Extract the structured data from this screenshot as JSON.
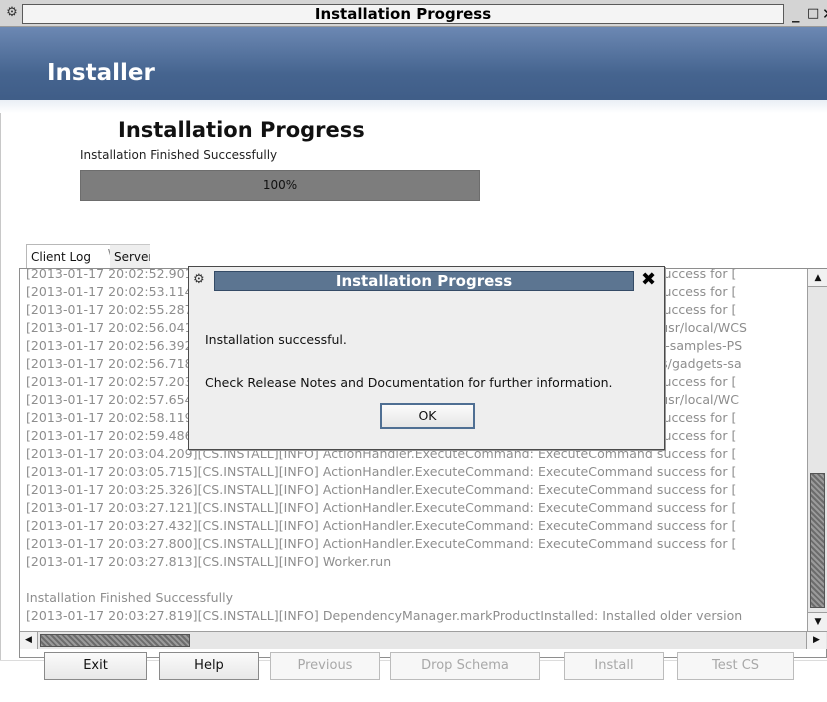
{
  "window": {
    "title": "Installation Progress",
    "menu_glyph": "⚙",
    "minimize_glyph": "_",
    "maximize_glyph": "□",
    "close_glyph": "✕"
  },
  "banner": {
    "title": "Installer"
  },
  "progress": {
    "heading": "Installation Progress",
    "status": "Installation Finished Successfully",
    "percent": 100,
    "label": "100%"
  },
  "tabs": [
    {
      "label": "Client Log",
      "active": true
    },
    {
      "label": "Server Log",
      "active": false
    }
  ],
  "log": {
    "lines": [
      "[2013-01-17 20:02:52.901][CS.INSTALL][INFO] ActionHandler.ExecuteCommand:  ExecuteCommand success for [",
      "[2013-01-17 20:02:53.114][CS.INSTALL][INFO] ActionHandler.ExecuteCommand:  ExecuteCommand success for [",
      "[2013-01-17 20:02:55.287][CS.INSTALL][INFO] ActionHandler.ExecuteCommand:  ExecuteCommand success for [",
      "[2013-01-17 20:02:56.041][CS.INSTALL][INFO] ActionHandler.ExecuteCommand:  Creating directory /usr/local/WCS",
      "[2013-01-17 20:02:56.392][CS.INSTALL][INFO] ActionHandler.ExecuteCommand:  Copying to /gadgets-samples-PS",
      "[2013-01-17 20:02:56.718][CS.INSTALL][INFO] ActionHandler.ExecuteCommand:  Copying to /home/cs/gadgets-sa",
      "[2013-01-17 20:02:57.203][CS.INSTALL][INFO] ActionHandler.ExecuteCommand:  ExecuteCommand success for [",
      "[2013-01-17 20:02:57.654][CS.INSTALL][INFO] ActionHandler.ExecuteCommand:  Creating directory /usr/local/WC",
      "[2013-01-17 20:02:58.119][CS.INSTALL][INFO] ActionHandler.ExecuteCommand:  ExecuteCommand success for [",
      "[2013-01-17 20:02:59.486][CS.INSTALL][INFO] ActionHandler.ExecuteCommand:  ExecuteCommand success for [",
      "[2013-01-17 20:03:04.209][CS.INSTALL][INFO] ActionHandler.ExecuteCommand:  ExecuteCommand success for [",
      "[2013-01-17 20:03:05.715][CS.INSTALL][INFO] ActionHandler.ExecuteCommand:  ExecuteCommand success for [",
      "[2013-01-17 20:03:25.326][CS.INSTALL][INFO] ActionHandler.ExecuteCommand:  ExecuteCommand success for [",
      "[2013-01-17 20:03:27.121][CS.INSTALL][INFO] ActionHandler.ExecuteCommand:  ExecuteCommand success for [",
      "[2013-01-17 20:03:27.432][CS.INSTALL][INFO] ActionHandler.ExecuteCommand:  ExecuteCommand success for [",
      "[2013-01-17 20:03:27.800][CS.INSTALL][INFO] ActionHandler.ExecuteCommand:  ExecuteCommand success for [",
      "[2013-01-17 20:03:27.813][CS.INSTALL][INFO] Worker.run",
      "",
      "Installation Finished Successfully",
      "[2013-01-17 20:03:27.819][CS.INSTALL][INFO] DependencyManager.markProductInstalled:  Installed older version"
    ]
  },
  "buttons": {
    "exit": "Exit",
    "help": "Help",
    "previous": "Previous",
    "drop_schema": "Drop Schema",
    "install": "Install",
    "test_cs": "Test CS"
  },
  "dialog": {
    "title": "Installation Progress",
    "message1": "Installation successful.",
    "message2": "Check Release Notes and Documentation for further information.",
    "ok": "OK",
    "close_glyph": "✖"
  },
  "scroll": {
    "up": "▲",
    "down": "▼",
    "left": "◀",
    "right": "▶"
  },
  "colors": {
    "banner": "#45648f",
    "dialog_title": "#5c7591",
    "progress_fill": "#7d7d7d"
  }
}
